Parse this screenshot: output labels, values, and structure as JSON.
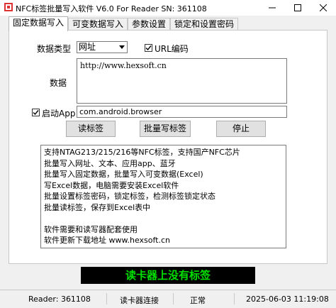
{
  "window": {
    "title": "NFC标签批量写入软件 V6.0 For Reader  SN:  361108",
    "icon": "nfc-app-icon",
    "controls": [
      "minimize-icon",
      "maximize-icon",
      "close-icon"
    ]
  },
  "tabs": [
    {
      "label": "固定数据写入",
      "active": true
    },
    {
      "label": "可变数据写入",
      "active": false
    },
    {
      "label": "参数设置",
      "active": false
    },
    {
      "label": "锁定和设置密码",
      "active": false
    }
  ],
  "form": {
    "data_type_label": "数据类型",
    "data_type_value": "网址",
    "url_encode_label": "URL编码",
    "url_encode_checked": true,
    "data_label": "数据",
    "data_value": "http://www.hexsoft.cn",
    "launch_app_label": "启动App",
    "launch_app_checked": true,
    "launch_app_value": "com.android.browser"
  },
  "buttons": {
    "read": "读标签",
    "batch_write": "批量写标签",
    "stop": "停止"
  },
  "info": {
    "lines": [
      "支持NTAG213/215/216等NFC标签，支持国产NFC芯片",
      "批量写入网址、文本、应用app、蓝牙",
      "批量写入固定数据，批量写入可变数据(Excel)",
      "写Excel数据，电脑需要安装Excel软件",
      "批量设置标签密码，锁定标签，检测标签锁定状态",
      "批量读标签，保存到Excel表中",
      "",
      "软件需要和读写器配套使用",
      "软件更新下载地址 www.hexsoft.cn"
    ]
  },
  "status_message": "读卡器上没有标签",
  "status_bar": {
    "reader": "Reader: 361108",
    "connection": "读卡器连接",
    "state": "正常",
    "datetime": "2025-06-03 11:19:08"
  },
  "colors": {
    "status_bg": "#000000",
    "status_text": "#00e000",
    "window_bg": "#f0f0f0"
  }
}
